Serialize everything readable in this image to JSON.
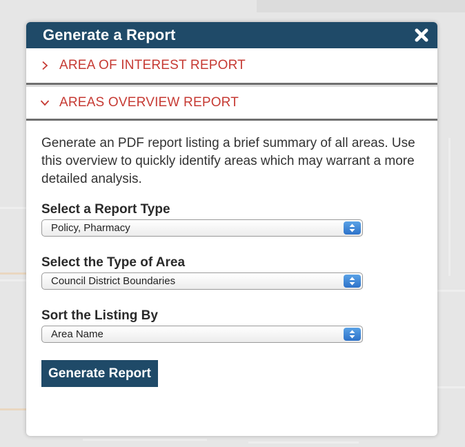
{
  "modal": {
    "title": "Generate a Report"
  },
  "accordion": {
    "items": [
      {
        "label": "AREA OF INTEREST REPORT",
        "expanded": false
      },
      {
        "label": "AREAS OVERVIEW REPORT",
        "expanded": true
      }
    ]
  },
  "overview_panel": {
    "description": "Generate an PDF report listing a brief summary of all areas. Use this overview to quickly identify areas which may warrant a more detailed analysis.",
    "fields": [
      {
        "label": "Select a Report Type",
        "value": "Policy, Pharmacy"
      },
      {
        "label": "Select the Type of Area",
        "value": "Council District Boundaries"
      },
      {
        "label": "Sort the Listing By",
        "value": "Area Name"
      }
    ],
    "submit_label": "Generate Report"
  },
  "colors": {
    "header_bg": "#1f4a68",
    "accordion_text": "#c63a33",
    "button_bg": "#1f4a68"
  },
  "icons": {
    "close": "close-icon",
    "collapsed": "chevron-right-icon",
    "expanded": "chevron-down-icon",
    "select": "select-arrows-icon"
  }
}
